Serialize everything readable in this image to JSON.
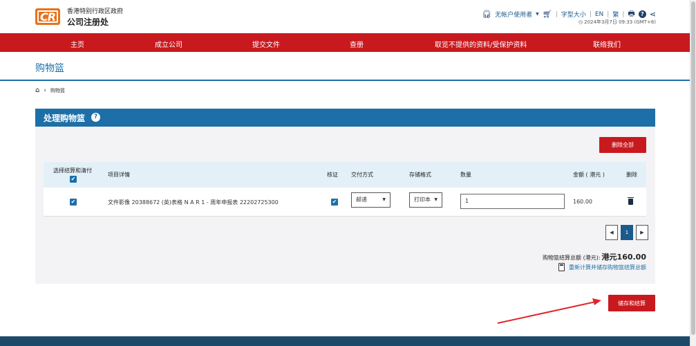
{
  "header": {
    "logo_text": "CR",
    "gov_title": "香港特别行政区政府",
    "org_title": "公司注册处",
    "account": "无帐户使用者",
    "font_size": "字型大小",
    "lang_en": "EN",
    "lang_tc": "繁",
    "datetime": "2024年3月7日 09:33 (GMT+8)"
  },
  "nav": {
    "items": [
      "主页",
      "成立公司",
      "提交文件",
      "查册",
      "取览不提供的资料/受保护资料",
      "联络我们"
    ]
  },
  "page": {
    "title": "购物篮",
    "breadcrumb": "购物篮"
  },
  "panel": {
    "title": "处理购物篮",
    "delete_all": "删除全部",
    "columns": {
      "select": "选择结算和清付",
      "item": "项目详情",
      "certify": "核证",
      "delivery": "交付方式",
      "format": "存储格式",
      "quantity": "数量",
      "amount": "金额 ( 港元 )",
      "delete": "删除"
    },
    "rows": [
      {
        "detail": "文件影像 20388672 (英)表格 N A R 1 - 周年申报表 22202725300",
        "delivery": "邮递",
        "format": "打印本",
        "quantity": "1",
        "amount": "160.00"
      }
    ],
    "pager": {
      "current": "1"
    },
    "total_label": "购物篮结算总额 (港元):",
    "total_amount": "港元160.00",
    "recalc": "重新计算并储存购物篮结算总额"
  },
  "actions": {
    "save_checkout": "储存和结算"
  },
  "colors": {
    "brand_red": "#c8191f",
    "brand_blue": "#1d6fa7",
    "logo_orange": "#e8711a"
  }
}
